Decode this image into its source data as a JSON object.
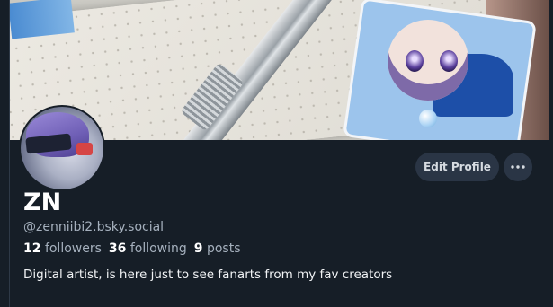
{
  "profile": {
    "display_name": "ZN",
    "handle": "@zenniibi2.bsky.social",
    "bio": "Digital artist, is here just to see fanarts from my fav creators",
    "stats": {
      "followers_count": "12",
      "followers_label": "followers",
      "following_count": "36",
      "following_label": "following",
      "posts_count": "9",
      "posts_label": "posts"
    }
  },
  "actions": {
    "edit_label": "Edit Profile",
    "more_icon": "ellipsis-icon"
  },
  "colors": {
    "background": "#161e27",
    "button_bg": "#2a3545",
    "muted_text": "#a5b0bd",
    "primary_text": "#ffffff"
  }
}
